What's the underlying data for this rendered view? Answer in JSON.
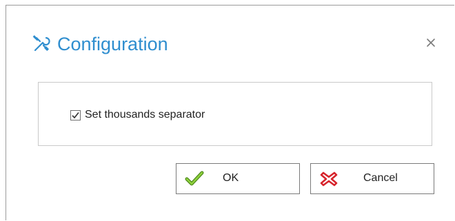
{
  "dialog": {
    "title": "Configuration",
    "title_icon": "tools-icon",
    "close_icon": "close-icon",
    "accent_color": "#2f8ecf"
  },
  "options": {
    "thousands_separator": {
      "label": "Set thousands separator",
      "checked": true
    }
  },
  "buttons": {
    "ok": {
      "label": "OK",
      "icon": "checkmark-icon",
      "color": "#6fa827"
    },
    "cancel": {
      "label": "Cancel",
      "icon": "red-x-icon",
      "color": "#d7252d"
    }
  }
}
